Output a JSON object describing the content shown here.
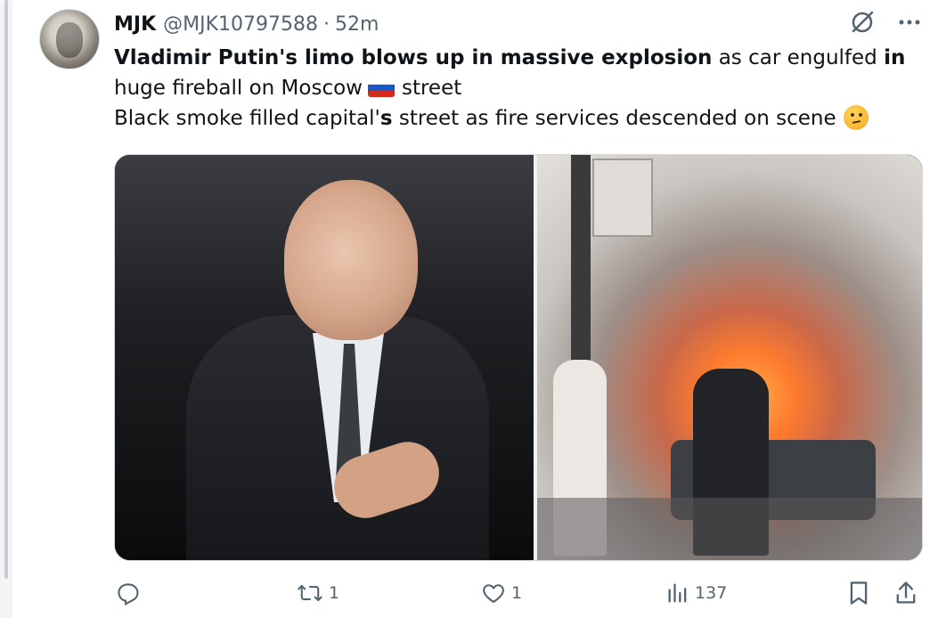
{
  "tweet": {
    "author_name": "MJK",
    "handle": "@MJK10797588",
    "separator": "·",
    "time": "52m",
    "line1_bold_a": "Vladimir Putin's limo blows up in massive explosion",
    "line1_normal": " as car engulfed ",
    "line1_bold_b": "in",
    "line2_a": "huge fireball on Moscow",
    "line2_b": "street",
    "line3_a": "Black smoke filled capital'",
    "line3_bold": "s",
    "line3_b": " street as fire services descended on scene"
  },
  "actions": {
    "reply_count": "",
    "retweet_count": "1",
    "like_count": "1",
    "view_count": "137"
  },
  "icons": {
    "reply": "reply-icon",
    "retweet": "retweet-icon",
    "like": "heart-icon",
    "views": "analytics-icon",
    "bookmark": "bookmark-icon",
    "share": "share-icon",
    "grok": "grok-icon",
    "more": "more-icon",
    "flag": "russia-flag-icon",
    "emoji": "thinking-face-icon"
  },
  "colors": {
    "text": "#0f1419",
    "secondary": "#536471",
    "border": "#cfd9de"
  }
}
